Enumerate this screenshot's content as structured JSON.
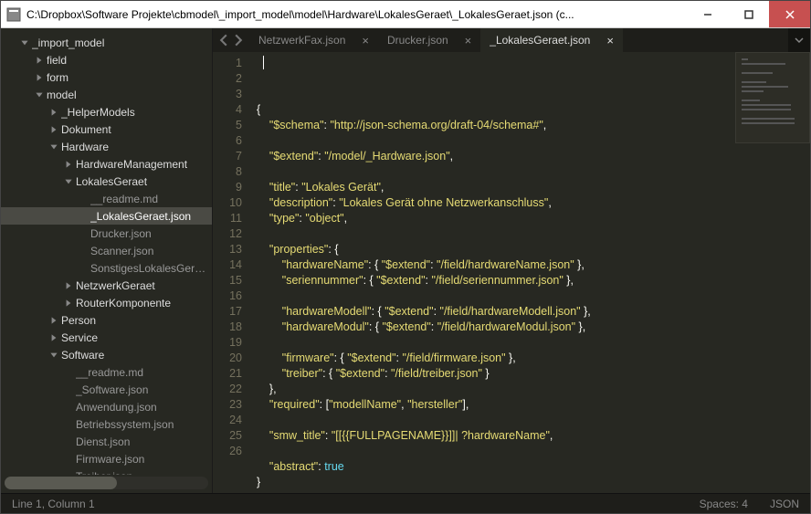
{
  "window": {
    "title": "C:\\Dropbox\\Software Projekte\\cbmodel\\_import_model\\model\\Hardware\\LokalesGeraet\\_LokalesGeraet.json (c..."
  },
  "tree": [
    {
      "depth": 0,
      "type": "folder",
      "expanded": true,
      "label": "_import_model"
    },
    {
      "depth": 1,
      "type": "folder",
      "expanded": false,
      "label": "field"
    },
    {
      "depth": 1,
      "type": "folder",
      "expanded": false,
      "label": "form"
    },
    {
      "depth": 1,
      "type": "folder",
      "expanded": true,
      "label": "model"
    },
    {
      "depth": 2,
      "type": "folder",
      "expanded": false,
      "label": "_HelperModels"
    },
    {
      "depth": 2,
      "type": "folder",
      "expanded": false,
      "label": "Dokument"
    },
    {
      "depth": 2,
      "type": "folder",
      "expanded": true,
      "label": "Hardware"
    },
    {
      "depth": 3,
      "type": "folder",
      "expanded": false,
      "label": "HardwareManagement"
    },
    {
      "depth": 3,
      "type": "folder",
      "expanded": true,
      "label": "LokalesGeraet"
    },
    {
      "depth": 4,
      "type": "file",
      "label": "__readme.md"
    },
    {
      "depth": 4,
      "type": "file",
      "label": "_LokalesGeraet.json",
      "selected": true
    },
    {
      "depth": 4,
      "type": "file",
      "label": "Drucker.json"
    },
    {
      "depth": 4,
      "type": "file",
      "label": "Scanner.json"
    },
    {
      "depth": 4,
      "type": "file",
      "label": "SonstigesLokalesGeraet.json"
    },
    {
      "depth": 3,
      "type": "folder",
      "expanded": false,
      "label": "NetzwerkGeraet"
    },
    {
      "depth": 3,
      "type": "folder",
      "expanded": false,
      "label": "RouterKomponente"
    },
    {
      "depth": 2,
      "type": "folder",
      "expanded": false,
      "label": "Person"
    },
    {
      "depth": 2,
      "type": "folder",
      "expanded": false,
      "label": "Service"
    },
    {
      "depth": 2,
      "type": "folder",
      "expanded": true,
      "label": "Software"
    },
    {
      "depth": 3,
      "type": "file",
      "label": "__readme.md"
    },
    {
      "depth": 3,
      "type": "file",
      "label": "_Software.json"
    },
    {
      "depth": 3,
      "type": "file",
      "label": "Anwendung.json"
    },
    {
      "depth": 3,
      "type": "file",
      "label": "Betriebssystem.json"
    },
    {
      "depth": 3,
      "type": "file",
      "label": "Dienst.json"
    },
    {
      "depth": 3,
      "type": "file",
      "label": "Firmware.json"
    },
    {
      "depth": 3,
      "type": "file",
      "label": "Treiber.json"
    }
  ],
  "tabs": [
    {
      "label": "NetzwerkFax.json",
      "active": false
    },
    {
      "label": "Drucker.json",
      "active": false
    },
    {
      "label": "_LokalesGeraet.json",
      "active": true
    }
  ],
  "code_lines": [
    [
      [
        "p",
        "{"
      ]
    ],
    [
      [
        "p",
        "    "
      ],
      [
        "s",
        "\"$schema\""
      ],
      [
        "p",
        ": "
      ],
      [
        "s",
        "\"http://json-schema.org/draft-04/schema#\""
      ],
      [
        "p",
        ","
      ]
    ],
    [],
    [
      [
        "p",
        "    "
      ],
      [
        "s",
        "\"$extend\""
      ],
      [
        "p",
        ": "
      ],
      [
        "s",
        "\"/model/_Hardware.json\""
      ],
      [
        "p",
        ","
      ]
    ],
    [],
    [
      [
        "p",
        "    "
      ],
      [
        "s",
        "\"title\""
      ],
      [
        "p",
        ": "
      ],
      [
        "s",
        "\"Lokales Gerät\""
      ],
      [
        "p",
        ","
      ]
    ],
    [
      [
        "p",
        "    "
      ],
      [
        "s",
        "\"description\""
      ],
      [
        "p",
        ": "
      ],
      [
        "s",
        "\"Lokales Gerät ohne Netzwerkanschluss\""
      ],
      [
        "p",
        ","
      ]
    ],
    [
      [
        "p",
        "    "
      ],
      [
        "s",
        "\"type\""
      ],
      [
        "p",
        ": "
      ],
      [
        "s",
        "\"object\""
      ],
      [
        "p",
        ","
      ]
    ],
    [],
    [
      [
        "p",
        "    "
      ],
      [
        "s",
        "\"properties\""
      ],
      [
        "p",
        ": {"
      ]
    ],
    [
      [
        "p",
        "        "
      ],
      [
        "s",
        "\"hardwareName\""
      ],
      [
        "p",
        ": { "
      ],
      [
        "s",
        "\"$extend\""
      ],
      [
        "p",
        ": "
      ],
      [
        "s",
        "\"/field/hardwareName.json\""
      ],
      [
        "p",
        " },"
      ]
    ],
    [
      [
        "p",
        "        "
      ],
      [
        "s",
        "\"seriennummer\""
      ],
      [
        "p",
        ": { "
      ],
      [
        "s",
        "\"$extend\""
      ],
      [
        "p",
        ": "
      ],
      [
        "s",
        "\"/field/seriennummer.json\""
      ],
      [
        "p",
        " },"
      ]
    ],
    [],
    [
      [
        "p",
        "        "
      ],
      [
        "s",
        "\"hardwareModell\""
      ],
      [
        "p",
        ": { "
      ],
      [
        "s",
        "\"$extend\""
      ],
      [
        "p",
        ": "
      ],
      [
        "s",
        "\"/field/hardwareModell.json\""
      ],
      [
        "p",
        " },"
      ]
    ],
    [
      [
        "p",
        "        "
      ],
      [
        "s",
        "\"hardwareModul\""
      ],
      [
        "p",
        ": { "
      ],
      [
        "s",
        "\"$extend\""
      ],
      [
        "p",
        ": "
      ],
      [
        "s",
        "\"/field/hardwareModul.json\""
      ],
      [
        "p",
        " },"
      ]
    ],
    [],
    [
      [
        "p",
        "        "
      ],
      [
        "s",
        "\"firmware\""
      ],
      [
        "p",
        ": { "
      ],
      [
        "s",
        "\"$extend\""
      ],
      [
        "p",
        ": "
      ],
      [
        "s",
        "\"/field/firmware.json\""
      ],
      [
        "p",
        " },"
      ]
    ],
    [
      [
        "p",
        "        "
      ],
      [
        "s",
        "\"treiber\""
      ],
      [
        "p",
        ": { "
      ],
      [
        "s",
        "\"$extend\""
      ],
      [
        "p",
        ": "
      ],
      [
        "s",
        "\"/field/treiber.json\""
      ],
      [
        "p",
        " }"
      ]
    ],
    [
      [
        "p",
        "    },"
      ]
    ],
    [
      [
        "p",
        "    "
      ],
      [
        "s",
        "\"required\""
      ],
      [
        "p",
        ": ["
      ],
      [
        "s",
        "\"modellName\""
      ],
      [
        "p",
        ", "
      ],
      [
        "s",
        "\"hersteller\""
      ],
      [
        "p",
        "],"
      ]
    ],
    [],
    [
      [
        "p",
        "    "
      ],
      [
        "s",
        "\"smw_title\""
      ],
      [
        "p",
        ": "
      ],
      [
        "s",
        "\"[[{{FULLPAGENAME}}]]| ?hardwareName\""
      ],
      [
        "p",
        ","
      ]
    ],
    [],
    [
      [
        "p",
        "    "
      ],
      [
        "s",
        "\"abstract\""
      ],
      [
        "p",
        ": "
      ],
      [
        "k",
        "true"
      ]
    ],
    [
      [
        "p",
        "}"
      ]
    ],
    []
  ],
  "status": {
    "position": "Line 1, Column 1",
    "spaces": "Spaces: 4",
    "syntax": "JSON"
  },
  "colors": {
    "accent": "#e6db74",
    "keyword": "#66d9ef",
    "bg": "#272822",
    "closeBtn": "#c75050"
  }
}
